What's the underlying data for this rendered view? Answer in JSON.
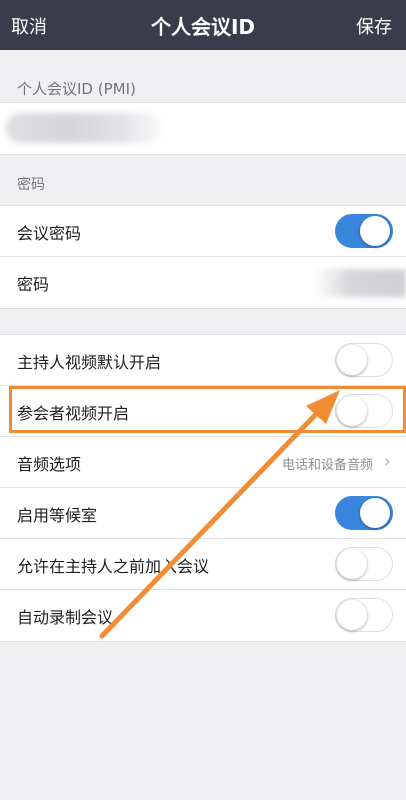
{
  "nav": {
    "cancel": "取消",
    "title": "个人会议ID",
    "save": "保存"
  },
  "pmi_section": {
    "header": "个人会议ID (PMI)"
  },
  "password_section": {
    "header": "密码",
    "meeting_password_label": "会议密码",
    "meeting_password_on": true,
    "password_label": "密码"
  },
  "options": {
    "host_video_label": "主持人视频默认开启",
    "host_video_on": false,
    "participant_video_label": "参会者视频开启",
    "participant_video_on": false,
    "audio_label": "音频选项",
    "audio_value": "电话和设备音频",
    "waiting_room_label": "启用等候室",
    "waiting_room_on": true,
    "join_before_host_label": "允许在主持人之前加入会议",
    "join_before_host_on": false,
    "auto_record_label": "自动录制会议",
    "auto_record_on": false
  },
  "colors": {
    "navbar": "#3b3c4b",
    "toggle_on": "#3b86dd",
    "annotation": "#f08c33"
  }
}
